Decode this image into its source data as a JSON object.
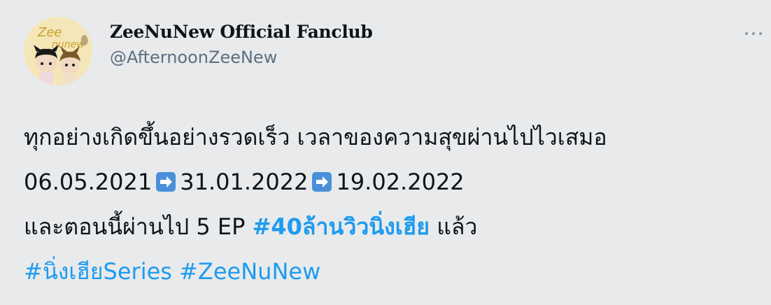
{
  "author": {
    "display_name": "ZeeNuNew Official Fanclub",
    "handle": "@AfternoonZeeNew",
    "avatar_icon": "fanclub-avatar"
  },
  "more_menu": {
    "icon": "more-horizontal-icon"
  },
  "tweet": {
    "line1": "ทุกอย่างเกิดขึ้นอย่างรวดเร็ว เวลาของความสุขผ่านไปไวเสมอ",
    "date1": "06.05.2021",
    "date2": "31.01.2022",
    "date3": "19.02.2022",
    "arrow_emoji": "right-arrow-emoji",
    "line3_prefix": "และตอนนี้ผ่านไป 5 EP",
    "hashtag_bold": "#40ล้านวิวนิ่งเฮีย",
    "line3_suffix": "แล้ว",
    "hashtag_series": "#นิ่งเฮียSeries",
    "hashtag_zeenunew": "#ZeeNuNew"
  },
  "colors": {
    "background": "#e9eaeb",
    "text": "#0f1419",
    "secondary_text": "#5b7083",
    "hashtag": "#1d9bf0",
    "emoji_blue": "#4a90d9"
  }
}
